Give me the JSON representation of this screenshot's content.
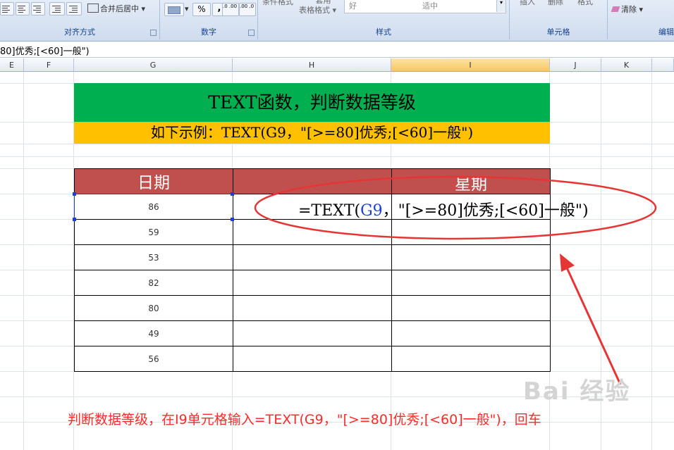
{
  "ribbon": {
    "merge_center": "合并后居中",
    "percent": "%",
    "comma": ",",
    "dec_inc": ".0 .00",
    "dec_dec": ".00 .0",
    "cond_format": "条件格式",
    "table_format_top": "套用",
    "table_format": "表格格式",
    "style_top": "好",
    "style_neutral": "适中",
    "insert": "插入",
    "delete": "删除",
    "format": "格式",
    "clear": "清除",
    "groups": {
      "alignment": "对齐方式",
      "number": "数字",
      "styles": "样式",
      "cells": "单元格",
      "editing": "编辑"
    }
  },
  "formula_bar": {
    "content": "80]优秀;[<60]一般\")"
  },
  "columns": [
    "E",
    "F",
    "G",
    "H",
    "I",
    "J",
    "K"
  ],
  "banner": {
    "title": "TEXT函数，判断数据等级",
    "example": "如下示例：TEXT(G9，\"[>=80]优秀;[<60]一般\")"
  },
  "table": {
    "headers": [
      "日期",
      "",
      "星期"
    ],
    "values": [
      "86",
      "59",
      "53",
      "82",
      "80",
      "49",
      "56"
    ]
  },
  "formula": {
    "prefix": "=TEXT(",
    "ref": "G9",
    "suffix": "，\"[>=80]优秀;[<60]一般\")"
  },
  "caption": "判断数据等级，在I9单元格输入=TEXT(G9，\"[>=80]优秀;[<60]一般\")，回车",
  "watermark": "Bai 经验",
  "colors": {
    "title_bg": "#00b050",
    "example_bg": "#ffc000",
    "header_bg": "#c0504d",
    "annotation": "#e53535",
    "ref": "#1f3fd6"
  }
}
